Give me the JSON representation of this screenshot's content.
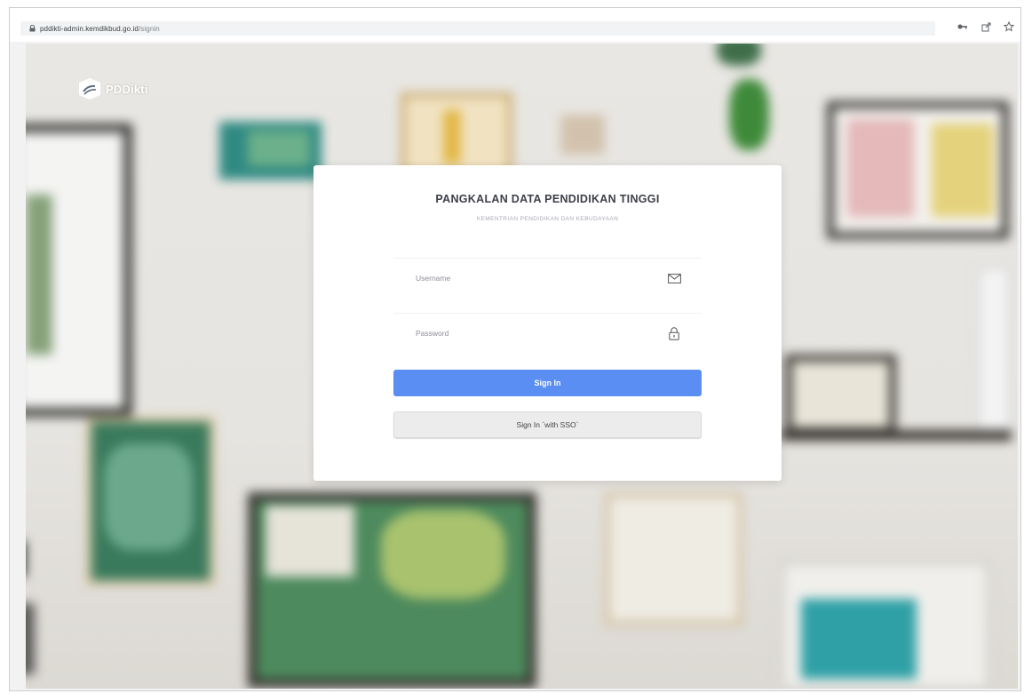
{
  "browser": {
    "url_host": "pddikti-admin.kemdikbud.go.id",
    "url_path": "/signin"
  },
  "logo": {
    "text": "PDDikti"
  },
  "card": {
    "title": "PANGKALAN DATA PENDIDIKAN TINGGI",
    "subtitle": "KEMENTRIAN PENDIDIKAN DAN KEBUDAYAAN"
  },
  "form": {
    "username_placeholder": "Username",
    "password_placeholder": "Password",
    "signin_label": "Sign In",
    "sso_label": "Sign In `with SSO`"
  },
  "colors": {
    "primary": "#5b8ef2",
    "card_bg": "#ffffff"
  }
}
